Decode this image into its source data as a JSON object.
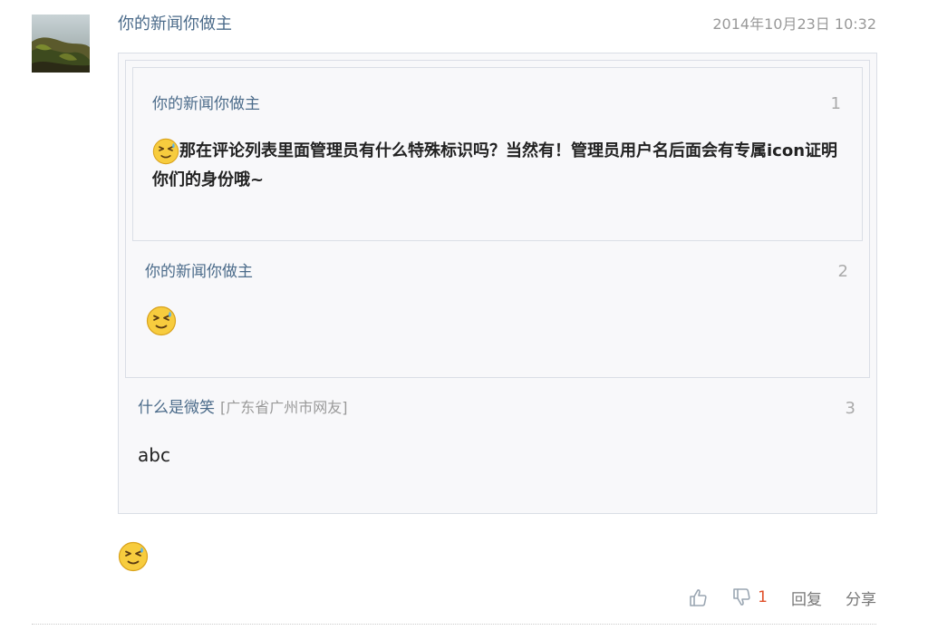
{
  "comment": {
    "username": "你的新闻你做主",
    "timestamp": "2014年10月23日 10:32",
    "emoji_icon": "grin-sweat-emoji-icon"
  },
  "quotes": [
    {
      "floor": "1",
      "username": "你的新闻你做主",
      "text": "那在评论列表里面管理员有什么特殊标识吗？当然有！管理员用户名后面会有专属icon证明你们的身份哦~"
    },
    {
      "floor": "2",
      "username": "你的新闻你做主"
    },
    {
      "floor": "3",
      "username": "什么是微笑",
      "location": "[广东省广州市网友]",
      "text": "abc"
    }
  ],
  "actions": {
    "like_icon": "thumbs-up-icon",
    "dislike_icon": "thumbs-down-icon",
    "dislike_count": "1",
    "reply_label": "回复",
    "share_label": "分享"
  },
  "colors": {
    "username": "#4b6b8a",
    "quote_bg": "#f8f8fa",
    "quote_border": "#dadee6",
    "count_accent": "#e0502a"
  }
}
